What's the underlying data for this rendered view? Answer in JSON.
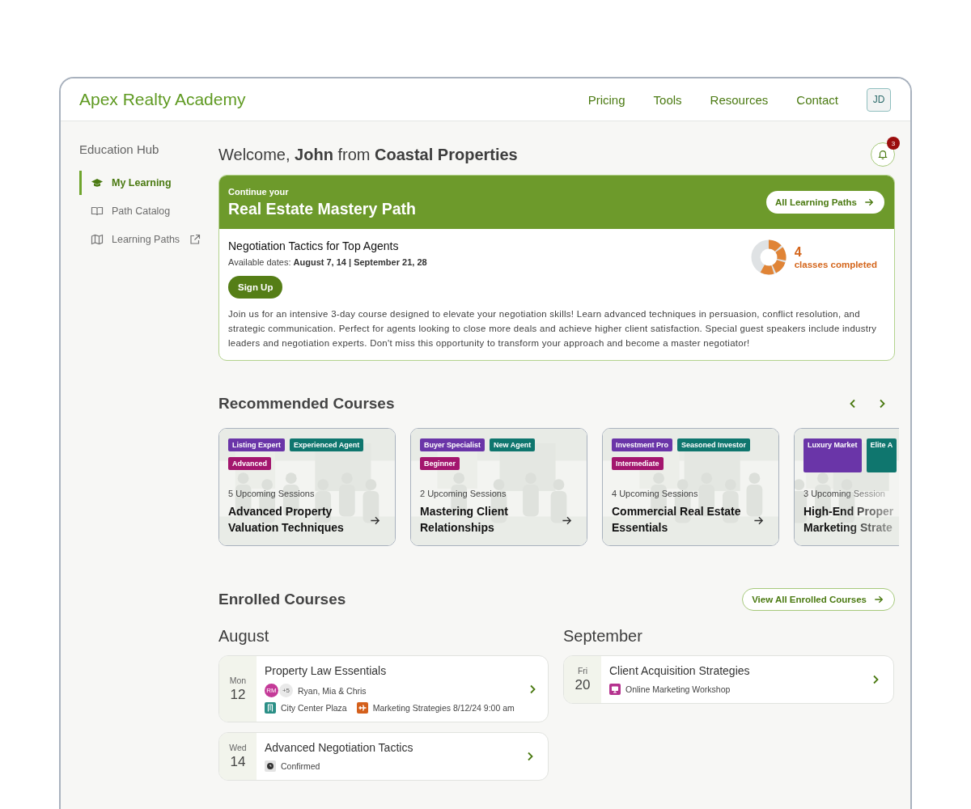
{
  "header": {
    "brand": "Apex Realty Academy",
    "nav": [
      "Pricing",
      "Tools",
      "Resources",
      "Contact"
    ],
    "avatar": "JD"
  },
  "sidebar": {
    "title": "Education Hub",
    "items": [
      {
        "label": "My Learning",
        "selected": true,
        "external": false
      },
      {
        "label": "Path Catalog",
        "selected": false,
        "external": false
      },
      {
        "label": "Learning Paths",
        "selected": false,
        "external": true
      }
    ]
  },
  "welcome": {
    "text": "Welcome, **John** from **Coastal Properties**",
    "notifications": "3"
  },
  "path_card": {
    "eyebrow": "Continue your",
    "title": "Real Estate Mastery Path",
    "button": "All Learning Paths",
    "course": "Negotiation Tactics for Top Agents",
    "dates": "Available dates: **August 7, 14 | September 21, 28**",
    "signup": "Sign Up",
    "completed_count": "4",
    "completed_label": "classes completed",
    "description": "Join us for an intensive 3-day course designed to elevate your negotiation skills! Learn advanced techniques in persuasion, conflict resolution, and strategic communication. Perfect for agents looking to close more deals and achieve higher client satisfaction. Special guest speakers include industry leaders and negotiation experts. Don't miss this opportunity to transform your approach and become a master negotiator!"
  },
  "recommended": {
    "title": "Recommended Courses",
    "courses": [
      {
        "tags": [
          {
            "label": "Listing Expert",
            "color": "#6a35a8"
          },
          {
            "label": "Experienced Agent",
            "color": "#0f766e"
          },
          {
            "label": "Advanced",
            "color": "#a3166e"
          }
        ],
        "sessions": "5 Upcoming Sessions",
        "title": "Advanced Property Valuation Techniques",
        "partial": false
      },
      {
        "tags": [
          {
            "label": "Buyer Specialist",
            "color": "#6a35a8"
          },
          {
            "label": "New Agent",
            "color": "#0f766e"
          },
          {
            "label": "Beginner",
            "color": "#a3166e"
          }
        ],
        "sessions": "2 Upcoming Sessions",
        "title": "Mastering Client Relationships",
        "partial": false
      },
      {
        "tags": [
          {
            "label": "Investment Pro",
            "color": "#6a35a8"
          },
          {
            "label": "Seasoned Investor",
            "color": "#0f766e"
          },
          {
            "label": "Intermediate",
            "color": "#a3166e"
          }
        ],
        "sessions": "4 Upcoming Sessions",
        "title": "Commercial Real Estate Essentials",
        "partial": false
      },
      {
        "tags": [
          {
            "label": "Luxury Market",
            "color": "#6a35a8"
          },
          {
            "label": "Elite A",
            "color": "#0f766e"
          }
        ],
        "sessions": "3 Upcoming Session",
        "title_lines": [
          "High-End Proper",
          "Marketing Strate"
        ],
        "partial": true
      }
    ]
  },
  "enrolled": {
    "title": "Enrolled Courses",
    "button": "View All Enrolled Courses",
    "months": [
      {
        "name": "August",
        "courses": [
          {
            "weekday": "Mon",
            "day": "12",
            "title": "Property Law Essentials",
            "meta": [
              {
                "kind": "attendees",
                "avatar": "RM",
                "more": "+5",
                "text": "Ryan, Mia & Chris"
              },
              {
                "kind": "location",
                "text": "City Center Plaza"
              },
              {
                "kind": "event",
                "text": "Marketing Strategies 8/12/24 9:00 am"
              }
            ]
          },
          {
            "weekday": "Wed",
            "day": "14",
            "title": "Advanced Negotiation Tactics",
            "meta": [
              {
                "kind": "status",
                "text": "Confirmed"
              }
            ]
          }
        ]
      },
      {
        "name": "September",
        "courses": [
          {
            "weekday": "Fri",
            "day": "20",
            "title": "Client Acquisition Strategies",
            "meta": [
              {
                "kind": "online",
                "text": "Online Marketing Workshop"
              }
            ]
          }
        ]
      }
    ]
  }
}
